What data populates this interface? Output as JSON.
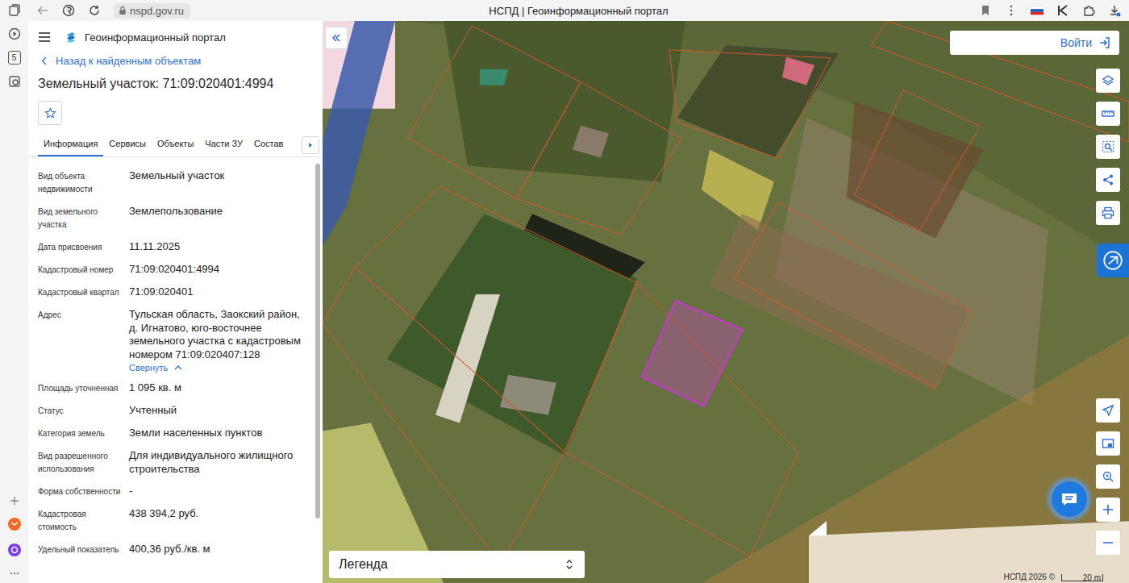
{
  "browser": {
    "address": "nspd.gov.ru",
    "title": "НСПД | Геоинформационный портал",
    "sidebar_badge": "5"
  },
  "header": {
    "portal": "Геоинформационный портал"
  },
  "back_link": "Назад к найденным объектам",
  "object_title": "Земельный участок: 71:09:020401:4994",
  "favorite": false,
  "tabs": [
    {
      "label": "Информация",
      "selected": true
    },
    {
      "label": "Сервисы",
      "selected": false
    },
    {
      "label": "Объекты",
      "selected": false
    },
    {
      "label": "Части ЗУ",
      "selected": false
    },
    {
      "label": "Состав",
      "selected": false
    }
  ],
  "fields": [
    {
      "label": "Вид объекта недвижимости",
      "value": "Земельный участок"
    },
    {
      "label": "Вид земельного участка",
      "value": "Землепользование"
    },
    {
      "label": "Дата присвоения",
      "value": "11.11.2025"
    },
    {
      "label": "Кадастровый номер",
      "value": "71:09:020401:4994"
    },
    {
      "label": "Кадастровый квартал",
      "value": "71:09:020401"
    },
    {
      "label": "Адрес",
      "value": "Тульская область, Заокский район, д. Игнатово, юго-восточнее земельного участка с кадастровым номером 71:09:020407:128",
      "toggle": "Свернуть",
      "expanded": true
    },
    {
      "label": "Площадь уточненная",
      "value": "1 095 кв. м"
    },
    {
      "label": "Статус",
      "value": "Учтенный"
    },
    {
      "label": "Категория земель",
      "value": "Земли населенных пунктов"
    },
    {
      "label": "Вид разрешенного использования",
      "value": "Для индивидуального жилищного строительства"
    },
    {
      "label": "Форма собственности",
      "value": "-"
    },
    {
      "label": "Кадастровая стоимость",
      "value": "438 394,2 руб."
    },
    {
      "label": "Удельный показатель",
      "value": "400,36 руб./кв. м"
    }
  ],
  "map": {
    "login": "Войти",
    "legend": "Легенда",
    "copyright": "НСПД 2026 ©",
    "scale": "20 m",
    "parcels": [
      {
        "selected": false
      },
      {
        "selected": false
      },
      {
        "selected": false
      },
      {
        "selected": false
      },
      {
        "selected": false
      },
      {
        "selected": false
      },
      {
        "selected": false
      },
      {
        "selected": true
      },
      {
        "selected": false
      },
      {
        "selected": false
      }
    ]
  }
}
